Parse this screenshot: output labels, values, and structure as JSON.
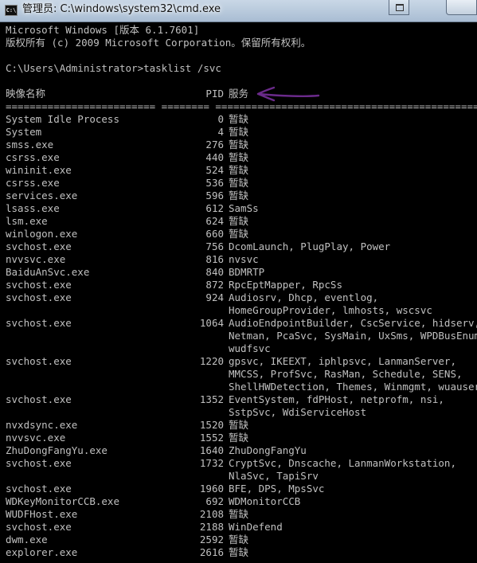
{
  "window": {
    "title": "管理员: C:\\windows\\system32\\cmd.exe",
    "icon_name": "cmd-icon"
  },
  "console": {
    "banner_line1": "Microsoft Windows [版本 6.1.7601]",
    "banner_line2": "版权所有 (c) 2009 Microsoft Corporation。保留所有权利。",
    "prompt_line": "C:\\Users\\Administrator>tasklist /svc",
    "header_image": "映像名称",
    "header_pid": "PID",
    "header_services": "服务",
    "separator": "========================= ======== ============================================",
    "annotation_color": "#6a2a8a",
    "rows": [
      {
        "image": "System Idle Process",
        "pid": "0",
        "services": "暂缺"
      },
      {
        "image": "System",
        "pid": "4",
        "services": "暂缺"
      },
      {
        "image": "smss.exe",
        "pid": "276",
        "services": "暂缺"
      },
      {
        "image": "csrss.exe",
        "pid": "440",
        "services": "暂缺"
      },
      {
        "image": "wininit.exe",
        "pid": "524",
        "services": "暂缺"
      },
      {
        "image": "csrss.exe",
        "pid": "536",
        "services": "暂缺"
      },
      {
        "image": "services.exe",
        "pid": "596",
        "services": "暂缺"
      },
      {
        "image": "lsass.exe",
        "pid": "612",
        "services": "SamSs"
      },
      {
        "image": "lsm.exe",
        "pid": "624",
        "services": "暂缺"
      },
      {
        "image": "winlogon.exe",
        "pid": "660",
        "services": "暂缺"
      },
      {
        "image": "svchost.exe",
        "pid": "756",
        "services": "DcomLaunch, PlugPlay, Power"
      },
      {
        "image": "nvvsvc.exe",
        "pid": "816",
        "services": "nvsvc"
      },
      {
        "image": "BaiduAnSvc.exe",
        "pid": "840",
        "services": "BDMRTP"
      },
      {
        "image": "svchost.exe",
        "pid": "872",
        "services": "RpcEptMapper, RpcSs"
      },
      {
        "image": "svchost.exe",
        "pid": "924",
        "services": "Audiosrv, Dhcp, eventlog,"
      },
      {
        "image": "",
        "pid": "",
        "services": "HomeGroupProvider, lmhosts, wscsvc"
      },
      {
        "image": "svchost.exe",
        "pid": "1064",
        "services": "AudioEndpointBuilder, CscService, hidserv,"
      },
      {
        "image": "",
        "pid": "",
        "services": "Netman, PcaSvc, SysMain, UxSms, WPDBusEnum,"
      },
      {
        "image": "",
        "pid": "",
        "services": "wudfsvc"
      },
      {
        "image": "svchost.exe",
        "pid": "1220",
        "services": "gpsvc, IKEEXT, iphlpsvc, LanmanServer,"
      },
      {
        "image": "",
        "pid": "",
        "services": "MMCSS, ProfSvc, RasMan, Schedule, SENS,"
      },
      {
        "image": "",
        "pid": "",
        "services": "ShellHWDetection, Themes, Winmgmt, wuauserv"
      },
      {
        "image": "svchost.exe",
        "pid": "1352",
        "services": "EventSystem, fdPHost, netprofm, nsi,"
      },
      {
        "image": "",
        "pid": "",
        "services": "SstpSvc, WdiServiceHost"
      },
      {
        "image": "nvxdsync.exe",
        "pid": "1520",
        "services": "暂缺"
      },
      {
        "image": "nvvsvc.exe",
        "pid": "1552",
        "services": "暂缺"
      },
      {
        "image": "ZhuDongFangYu.exe",
        "pid": "1640",
        "services": "ZhuDongFangYu"
      },
      {
        "image": "svchost.exe",
        "pid": "1732",
        "services": "CryptSvc, Dnscache, LanmanWorkstation,"
      },
      {
        "image": "",
        "pid": "",
        "services": "NlaSvc, TapiSrv"
      },
      {
        "image": "svchost.exe",
        "pid": "1960",
        "services": "BFE, DPS, MpsSvc"
      },
      {
        "image": "WDKeyMonitorCCB.exe",
        "pid": "692",
        "services": "WDMonitorCCB"
      },
      {
        "image": "WUDFHost.exe",
        "pid": "2108",
        "services": "暂缺"
      },
      {
        "image": "svchost.exe",
        "pid": "2188",
        "services": "WinDefend"
      },
      {
        "image": "dwm.exe",
        "pid": "2592",
        "services": "暂缺"
      },
      {
        "image": "explorer.exe",
        "pid": "2616",
        "services": "暂缺"
      }
    ]
  }
}
